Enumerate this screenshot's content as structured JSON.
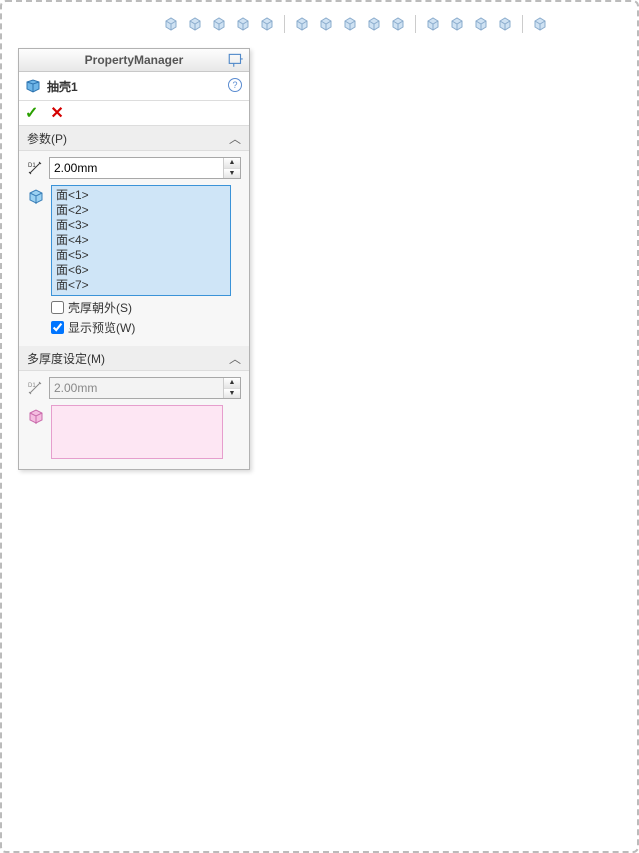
{
  "header": {
    "title": "PropertyManager"
  },
  "feature": {
    "name": "抽壳1"
  },
  "sections": {
    "params": {
      "title": "参数(P)",
      "thickness": "2.00mm",
      "faces": [
        "面<1>",
        "面<2>",
        "面<3>",
        "面<4>",
        "面<5>",
        "面<6>",
        "面<7>"
      ],
      "shellOutward": {
        "label": "壳厚朝外(S)",
        "checked": false
      },
      "showPreview": {
        "label": "显示预览(W)",
        "checked": true
      }
    },
    "multi": {
      "title": "多厚度设定(M)",
      "thickness": "2.00mm"
    }
  },
  "toolbar_icons": [
    "axis-icon",
    "zoom-icon",
    "orbit-icon",
    "measure-icon",
    "section-icon",
    "sep",
    "iso-icon",
    "shading-icon",
    "appearance-icon",
    "render-icon",
    "scene-icon",
    "sep",
    "hide-icon",
    "print-icon",
    "layers-icon",
    "display-icon",
    "sep",
    "monitor-icon"
  ]
}
